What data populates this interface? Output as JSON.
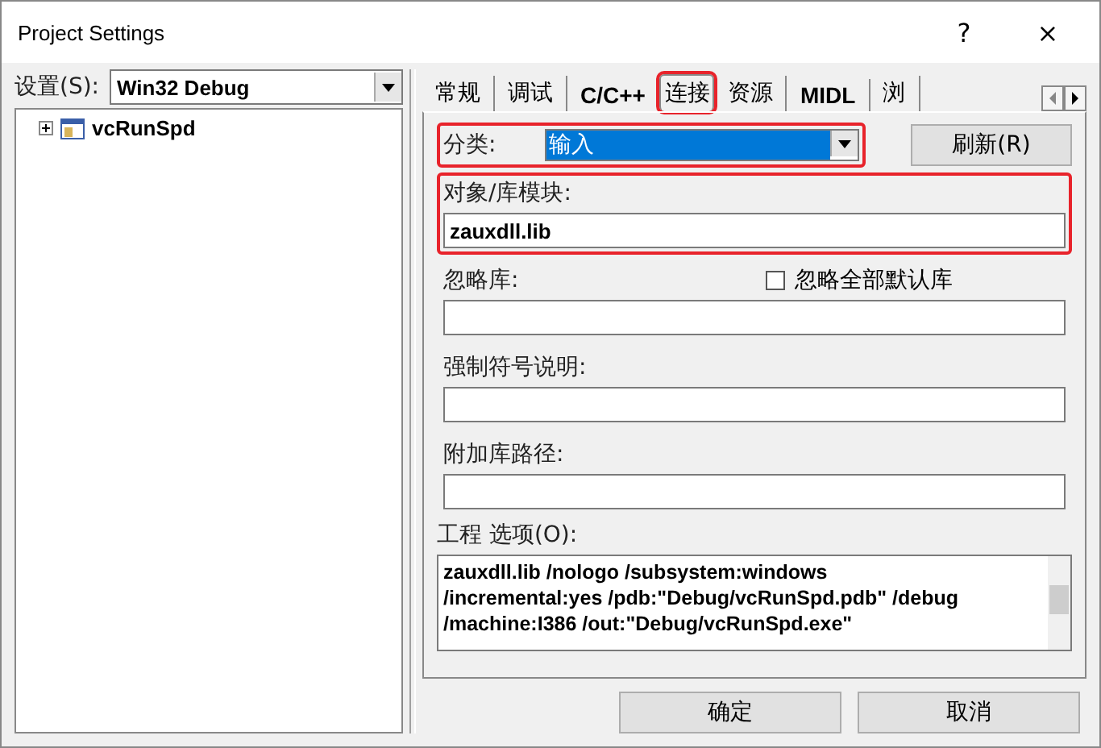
{
  "window": {
    "title": "Project Settings",
    "help": "?",
    "close": "×"
  },
  "settings": {
    "label": "设置(S):",
    "value": "Win32 Debug"
  },
  "tree": [
    {
      "label": "vcRunSpd",
      "expanded": false
    }
  ],
  "tabs": [
    {
      "label": "常规",
      "selected": false,
      "highlighted": false
    },
    {
      "label": "调试",
      "selected": false,
      "highlighted": false
    },
    {
      "label": "C/C++",
      "selected": false,
      "highlighted": false
    },
    {
      "label": "连接",
      "selected": true,
      "highlighted": true
    },
    {
      "label": "资源",
      "selected": false,
      "highlighted": false
    },
    {
      "label": "MIDL",
      "selected": false,
      "highlighted": false
    },
    {
      "label": "浏",
      "selected": false,
      "highlighted": false
    }
  ],
  "category": {
    "label": "分类:",
    "value": "输入",
    "highlighted": true
  },
  "reset_button": "刷新(R)",
  "fields": [
    {
      "label": "对象/库模块:",
      "value": "zauxdll.lib",
      "highlighted": true
    },
    {
      "label": "忽略库:",
      "highlighted": false,
      "checkbox": {
        "label": "忽略全部默认库",
        "checked": false
      }
    },
    {
      "label": "强制符号说明:",
      "highlighted": false
    },
    {
      "label": "附加库路径:",
      "highlighted": false
    }
  ],
  "options": {
    "label": "工程 选项(O):",
    "lines": [
      "zauxdll.lib /nologo /subsystem:windows",
      "/incremental:yes /pdb:\"Debug/vcRunSpd.pdb\" /debug",
      "/machine:I386 /out:\"Debug/vcRunSpd.exe\""
    ]
  },
  "buttons": [
    "确定",
    "取消"
  ]
}
